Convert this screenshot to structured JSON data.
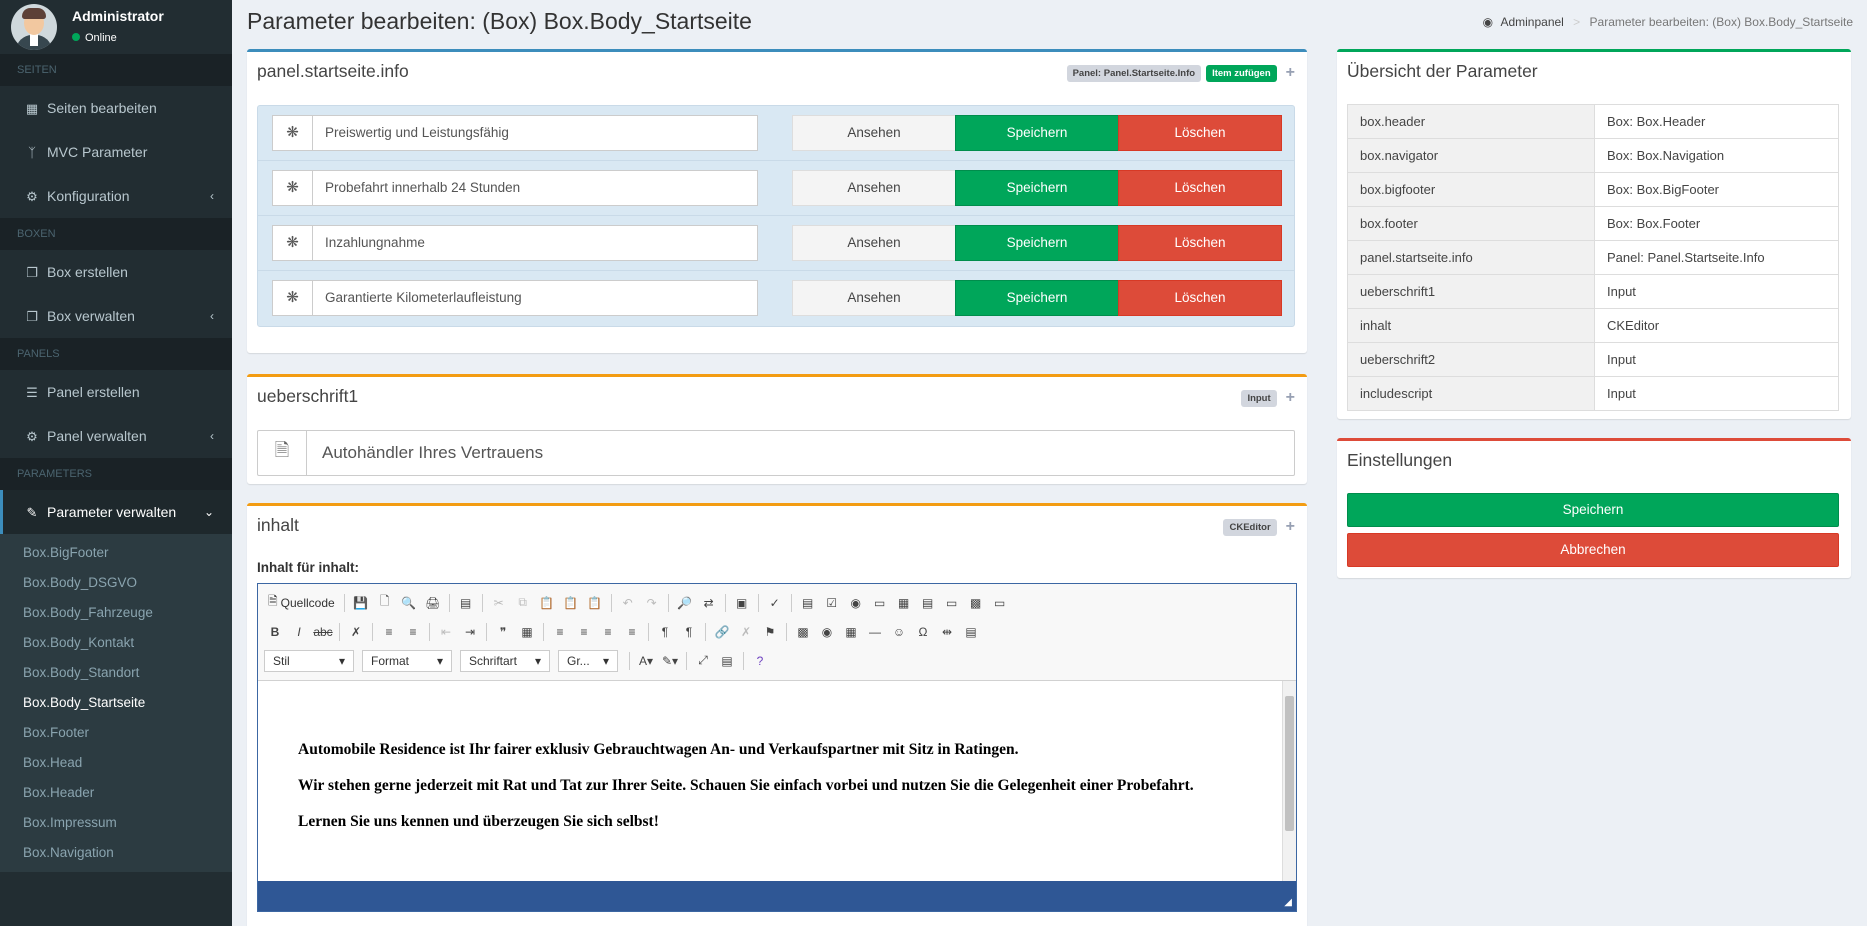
{
  "user": {
    "name": "Administrator",
    "status": "Online"
  },
  "sidebar": {
    "sections": [
      {
        "header": "SEITEN",
        "items": [
          {
            "label": "Seiten bearbeiten",
            "icon": "map-icon"
          },
          {
            "label": "MVC Parameter",
            "icon": "code-fork-icon"
          },
          {
            "label": "Konfiguration",
            "icon": "gear-icon",
            "has_chevron": true
          }
        ]
      },
      {
        "header": "BOXEN",
        "items": [
          {
            "label": "Box erstellen",
            "icon": "cube-icon"
          },
          {
            "label": "Box verwalten",
            "icon": "cubes-icon",
            "has_chevron": true
          }
        ]
      },
      {
        "header": "PANELS",
        "items": [
          {
            "label": "Panel erstellen",
            "icon": "tasks-icon"
          },
          {
            "label": "Panel verwalten",
            "icon": "gears-icon",
            "has_chevron": true
          }
        ]
      },
      {
        "header": "PARAMETERS",
        "items": []
      }
    ],
    "active_item": {
      "label": "Parameter verwalten",
      "icon": "edit-icon"
    },
    "submenu": [
      "Box.BigFooter",
      "Box.Body_DSGVO",
      "Box.Body_Fahrzeuge",
      "Box.Body_Kontakt",
      "Box.Body_Standort",
      "Box.Body_Startseite",
      "Box.Footer",
      "Box.Head",
      "Box.Header",
      "Box.Impressum",
      "Box.Navigation"
    ],
    "submenu_active": "Box.Body_Startseite"
  },
  "page": {
    "title": "Parameter bearbeiten: (Box) Box.Body_Startseite",
    "breadcrumb": {
      "home": "Adminpanel",
      "current": "Parameter bearbeiten: (Box) Box.Body_Startseite"
    }
  },
  "panel_box": {
    "title": "panel.startseite.info",
    "badge": "Panel: Panel.Startseite.Info",
    "add_label": "Item zufügen",
    "items": [
      "Preiswertig und Leistungsfähig",
      "Probefahrt innerhalb 24 Stunden",
      "Inzahlungnahme",
      "Garantierte Kilometerlaufleistung"
    ],
    "view_label": "Ansehen",
    "save_label": "Speichern",
    "delete_label": "Löschen"
  },
  "heading_box": {
    "title": "ueberschrift1",
    "badge": "Input",
    "value": "Autohändler Ihres Vertrauens"
  },
  "content_box": {
    "title": "inhalt",
    "badge": "CKEditor",
    "field_label": "Inhalt für inhalt:",
    "toolbar": {
      "source_label": "Quellcode",
      "combos": [
        "Stil",
        "Format",
        "Schriftart",
        "Gr..."
      ]
    },
    "paragraphs": [
      "Automobile Residence ist Ihr fairer exklusiv Gebrauchtwagen An- und Verkaufspartner mit Sitz in Ratingen.",
      "Wir stehen gerne jederzeit mit Rat und Tat zur Ihrer Seite. Schauen Sie einfach vorbei und nutzen Sie die Gelegenheit einer Probefahrt.",
      "Lernen Sie uns kennen und überzeugen Sie sich selbst!"
    ]
  },
  "overview": {
    "title": "Übersicht der Parameter",
    "rows": [
      [
        "box.header",
        "Box: Box.Header"
      ],
      [
        "box.navigator",
        "Box: Box.Navigation"
      ],
      [
        "box.bigfooter",
        "Box: Box.BigFooter"
      ],
      [
        "box.footer",
        "Box: Box.Footer"
      ],
      [
        "panel.startseite.info",
        "Panel: Panel.Startseite.Info"
      ],
      [
        "ueberschrift1",
        "Input"
      ],
      [
        "inhalt",
        "CKEditor"
      ],
      [
        "ueberschrift2",
        "Input"
      ],
      [
        "includescript",
        "Input"
      ]
    ]
  },
  "settings": {
    "title": "Einstellungen",
    "save_label": "Speichern",
    "cancel_label": "Abbrechen"
  },
  "colors": {
    "sidebar": "#222d32",
    "primary": "#3c8dbc",
    "success": "#00a65a",
    "danger": "#dd4b39",
    "warning": "#f39c12"
  }
}
